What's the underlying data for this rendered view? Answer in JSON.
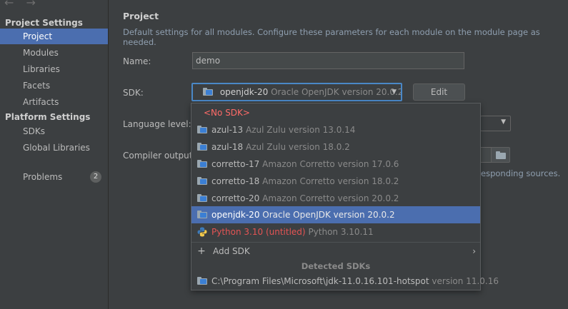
{
  "sidebar": {
    "nav_arrows": "← →",
    "project_settings_header": "Project Settings",
    "project_items": [
      {
        "label": "Project"
      },
      {
        "label": "Modules"
      },
      {
        "label": "Libraries"
      },
      {
        "label": "Facets"
      },
      {
        "label": "Artifacts"
      }
    ],
    "platform_settings_header": "Platform Settings",
    "platform_items": [
      {
        "label": "SDKs"
      },
      {
        "label": "Global Libraries"
      }
    ],
    "problems": {
      "label": "Problems",
      "count": "2"
    }
  },
  "main": {
    "title": "Project",
    "description": "Default settings for all modules. Configure these parameters for each module on the module page as needed.",
    "name_label": "Name:",
    "name_value": "demo",
    "sdk_label": "SDK:",
    "sdk_selected_name": "openjdk-20",
    "sdk_selected_version": "Oracle OpenJDK version 20.0.2",
    "edit_label": "Edit",
    "language_level_label": "Language level:",
    "compiler_output_label": "Compiler output:",
    "hint_text": "esponding sources."
  },
  "popup": {
    "no_sdk": "<No SDK>",
    "items": [
      {
        "name": "azul-13",
        "version": "Azul Zulu version 13.0.14",
        "icon": "jdk-folder-icon"
      },
      {
        "name": "azul-18",
        "version": "Azul Zulu version 18.0.2",
        "icon": "jdk-folder-icon"
      },
      {
        "name": "corretto-17",
        "version": "Amazon Corretto version 17.0.6",
        "icon": "jdk-folder-icon"
      },
      {
        "name": "corretto-18",
        "version": "Amazon Corretto version 18.0.2",
        "icon": "jdk-folder-icon"
      },
      {
        "name": "corretto-20",
        "version": "Amazon Corretto version 20.0.2",
        "icon": "jdk-folder-icon"
      },
      {
        "name": "openjdk-20",
        "version": "Oracle OpenJDK version 20.0.2",
        "icon": "jdk-folder-icon"
      }
    ],
    "python": {
      "name": "Python 3.10 (untitled)",
      "version": "Python 3.10.11",
      "icon": "python-icon"
    },
    "add_sdk": "Add SDK",
    "detected_header": "Detected SDKs",
    "detected": {
      "name": "C:\\Program Files\\Microsoft\\jdk-11.0.16.101-hotspot",
      "version": "version 11.0.16",
      "icon": "jdk-folder-icon"
    }
  },
  "colors": {
    "background": "#3c3f41",
    "selection": "#4b6eaf",
    "focus_border": "#4a88c7",
    "error_red": "#ff6b68"
  }
}
